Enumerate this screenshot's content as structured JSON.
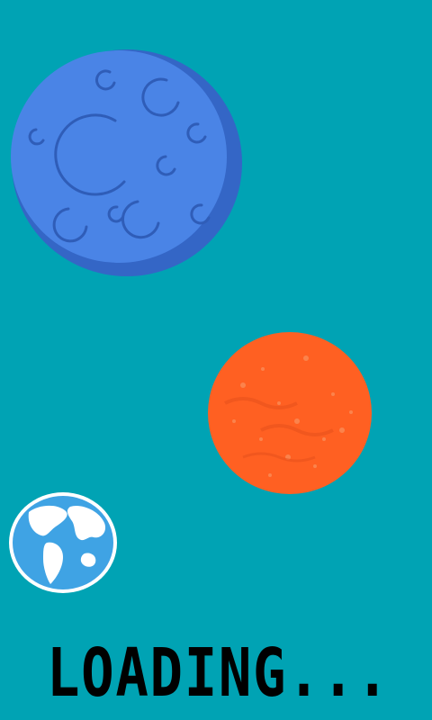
{
  "scene": {
    "background_color": "#00A3B4",
    "loading_label": "LOADING...",
    "planets": [
      {
        "name": "moon",
        "icon": "cratered-moon-icon",
        "color": "#4A84E6",
        "shadow_color": "#3466C6"
      },
      {
        "name": "mars",
        "icon": "mars-planet-icon",
        "color": "#FF6022",
        "texture_color": "#F25A1E"
      },
      {
        "name": "earth",
        "icon": "earth-globe-icon",
        "ocean_color": "#3FA3E4",
        "land_color": "#FFFFFF"
      }
    ]
  }
}
